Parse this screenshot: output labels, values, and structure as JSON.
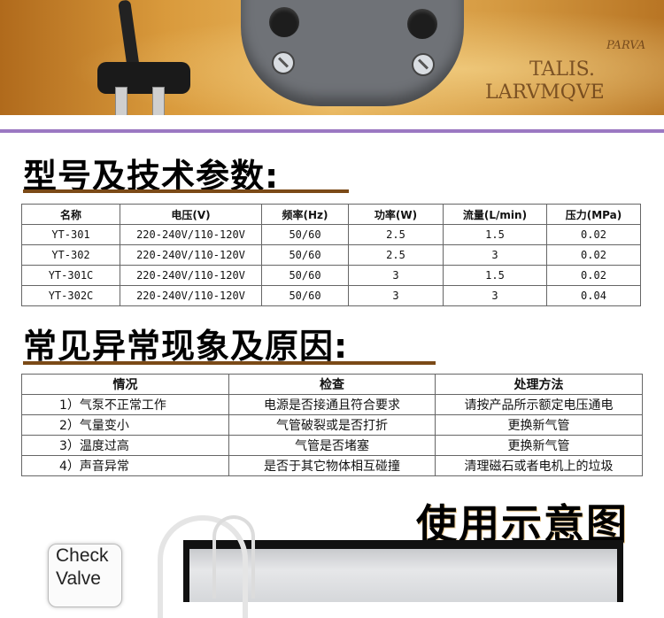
{
  "banner": {
    "map_text_1": "TALIS.",
    "map_text_2": "LARVMQVE",
    "map_text_3": "PARVA"
  },
  "section1": {
    "title": "型号及技术参数:",
    "headers": [
      "名称",
      "电压(V)",
      "频率(Hz)",
      "功率(W)",
      "流量(L/min)",
      "压力(MPa)"
    ],
    "rows": [
      [
        "YT-301",
        "220-240V/110-120V",
        "50/60",
        "2.5",
        "1.5",
        "0.02"
      ],
      [
        "YT-302",
        "220-240V/110-120V",
        "50/60",
        "2.5",
        "3",
        "0.02"
      ],
      [
        "YT-301C",
        "220-240V/110-120V",
        "50/60",
        "3",
        "1.5",
        "0.02"
      ],
      [
        "YT-302C",
        "220-240V/110-120V",
        "50/60",
        "3",
        "3",
        "0.04"
      ]
    ]
  },
  "section2": {
    "title": "常见异常现象及原因:",
    "headers": [
      "情况",
      "检查",
      "处理方法"
    ],
    "rows": [
      [
        "1）气泵不正常工作",
        "电源是否接通且符合要求",
        "请按产品所示额定电压通电"
      ],
      [
        "2）气量变小",
        "气管破裂或是否打折",
        "更换新气管"
      ],
      [
        "3）温度过高",
        "气管是否堵塞",
        "更换新气管"
      ],
      [
        "4）声音异常",
        "是否于其它物体相互碰撞",
        "清理磁石或者电机上的垃圾"
      ]
    ]
  },
  "usage": {
    "title": "使用示意图",
    "check_valve_line1": "Check",
    "check_valve_line2": "Valve"
  }
}
